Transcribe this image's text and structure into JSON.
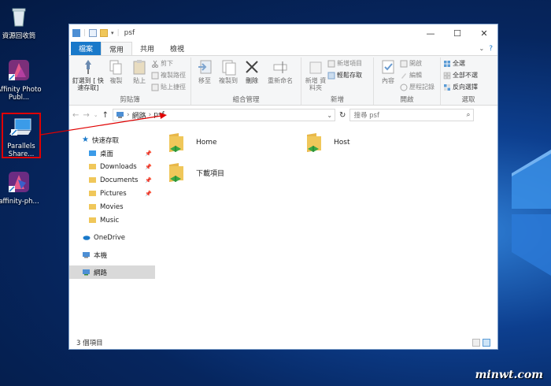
{
  "desktop": {
    "icons": [
      {
        "label": "資源回收筒"
      },
      {
        "label": "Affinity Photo Publ..."
      },
      {
        "label": "Parallels Share..."
      },
      {
        "label": "affinity-ph..."
      }
    ],
    "watermark": "minwt.com"
  },
  "window": {
    "title": "psf",
    "controls": {
      "minimize": "—",
      "maximize": "☐",
      "close": "✕"
    },
    "tabs": [
      {
        "label": "檔案"
      },
      {
        "label": "常用"
      },
      {
        "label": "共用"
      },
      {
        "label": "檢視"
      }
    ],
    "ribbon": {
      "clipboard": {
        "name": "剪貼簿",
        "pin": "釘選到 [ 快速存取]",
        "copy": "複製",
        "paste": "貼上",
        "cut": "剪下",
        "copy_path": "複製路徑",
        "paste_shortcut": "貼上捷徑"
      },
      "organize": {
        "name": "組合管理",
        "move_to": "移至",
        "copy_to": "複製到",
        "delete": "刪除",
        "rename": "重新命名"
      },
      "new": {
        "name": "新增",
        "new_folder": "新增 資料夾",
        "new_item": "新增項目",
        "easy_access": "輕鬆存取"
      },
      "open": {
        "name": "開啟",
        "properties": "內容",
        "open": "開啟",
        "edit": "編輯",
        "history": "歷程記錄"
      },
      "select": {
        "name": "選取",
        "select_all": "全選",
        "select_none": "全部不選",
        "invert": "反向選擇"
      }
    },
    "address": {
      "segments": [
        "網路",
        "psf"
      ],
      "search_placeholder": "搜尋 psf"
    },
    "nav_pane": [
      {
        "label": "快速存取",
        "pinned": false
      },
      {
        "label": "桌面",
        "pinned": true
      },
      {
        "label": "Downloads",
        "pinned": true
      },
      {
        "label": "Documents",
        "pinned": true
      },
      {
        "label": "Pictures",
        "pinned": true
      },
      {
        "label": "Movies",
        "pinned": false
      },
      {
        "label": "Music",
        "pinned": false
      },
      {
        "label": "OneDrive",
        "pinned": false
      },
      {
        "label": "本機",
        "pinned": false
      },
      {
        "label": "網路",
        "pinned": false
      }
    ],
    "files": [
      {
        "name": "Home"
      },
      {
        "name": "Host"
      },
      {
        "name": "下載項目"
      }
    ],
    "status": "3 個項目"
  },
  "colors": {
    "file_tab": "#1979ca",
    "highlight": "#e00000",
    "folder": "#f0c75a"
  }
}
